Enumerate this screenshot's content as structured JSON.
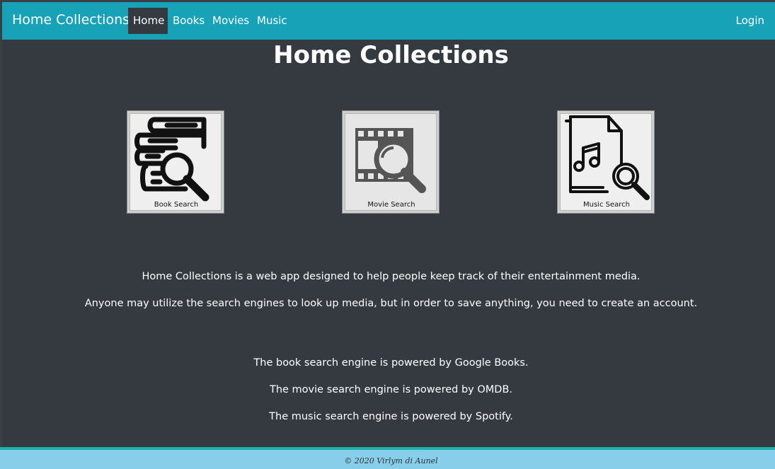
{
  "navbar": {
    "brand": "Home Collections",
    "links": [
      "Home",
      "Books",
      "Movies",
      "Music"
    ],
    "active": "Home",
    "login": "Login",
    "color": "#17a2b8"
  },
  "main": {
    "title": "Home Collections",
    "cards": [
      {
        "label": "Book Search",
        "icon": "book-search-icon"
      },
      {
        "label": "Movie Search",
        "icon": "movie-search-icon"
      },
      {
        "label": "Music Search",
        "icon": "music-search-icon"
      }
    ],
    "intro": [
      "Home Collections is a web app designed to help people keep track of their entertainment media.",
      "Anyone may utilize the search engines to look up media, but in order to save anything, you need to create an account."
    ],
    "credits": [
      "The book search engine is powered by Google Books.",
      "The movie search engine is powered by OMDB.",
      "The music search engine is powered by Spotify."
    ]
  },
  "footer": {
    "text": "© 2020 Virlym di Aunel"
  }
}
